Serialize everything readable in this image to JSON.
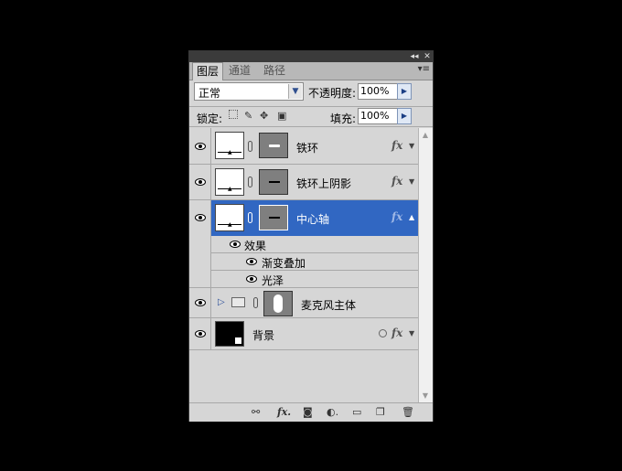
{
  "window": {
    "collapse_glyph": "◂◂",
    "close_glyph": "✕"
  },
  "tabs": [
    {
      "label": "图层",
      "active": true
    },
    {
      "label": "通道",
      "active": false
    },
    {
      "label": "路径",
      "active": false
    }
  ],
  "panel_menu_glyph": "▾≡",
  "blend_mode": {
    "value": "正常",
    "arrow": "▼"
  },
  "opacity": {
    "label": "不透明度:",
    "value": "100%",
    "arrow": "▶"
  },
  "lock": {
    "label": "锁定:"
  },
  "fill": {
    "label": "填充:",
    "value": "100%",
    "arrow": "▶"
  },
  "layers": [
    {
      "name": "铁环",
      "fx": "fx",
      "selected": false
    },
    {
      "name": "铁环上阴影",
      "fx": "fx",
      "selected": false
    },
    {
      "name": "中心轴",
      "fx": "fx",
      "selected": true
    },
    {
      "name": "麦克风主体",
      "group": true
    },
    {
      "name": "背景",
      "fx": "fx",
      "background": true
    }
  ],
  "effects": {
    "header": "效果",
    "items": [
      "渐变叠加",
      "光泽"
    ]
  },
  "bottom_icons": [
    "link-layers-icon",
    "layer-style-icon",
    "add-mask-icon",
    "adjustment-layer-icon",
    "new-group-icon",
    "new-layer-icon",
    "delete-layer-icon"
  ]
}
